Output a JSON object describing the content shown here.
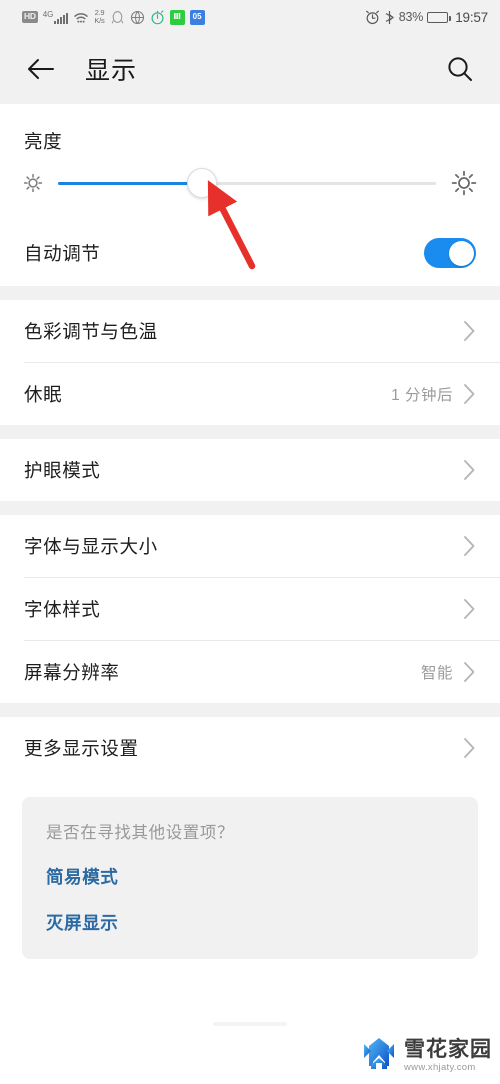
{
  "statusbar": {
    "hd_badge": "HD",
    "network_gen": "4G",
    "data_speed_value": "2.9",
    "data_speed_unit": "K/s",
    "icons": [
      "hd-badge",
      "signal-bars-icon",
      "wifi-icon",
      "data-speed-indicator",
      "qq-penguin-icon",
      "globe-icon",
      "stopwatch-icon",
      "green-app-icon",
      "blue-app-icon",
      "alarm-clock-icon",
      "bluetooth-icon",
      "battery-icon"
    ],
    "green_app_glyph": "Ⅲ",
    "blue_app_glyph": "05",
    "battery_percent": "83%",
    "battery_level": 83,
    "clock": "19:57"
  },
  "header": {
    "back_icon": "arrow-left-icon",
    "title": "显示",
    "search_icon": "search-icon"
  },
  "brightness": {
    "section_title": "亮度",
    "low_icon": "sun-low-icon",
    "high_icon": "sun-high-icon",
    "slider_percent": 38,
    "auto_row": {
      "label": "自动调节",
      "toggle_on": true,
      "toggle_color": "#1a8cf0"
    }
  },
  "groups": [
    {
      "rows": [
        {
          "label": "色彩调节与色温",
          "value": "",
          "chevron": true
        },
        {
          "label": "休眠",
          "value": "1 分钟后",
          "chevron": true
        }
      ]
    },
    {
      "rows": [
        {
          "label": "护眼模式",
          "value": "",
          "chevron": true
        }
      ]
    },
    {
      "rows": [
        {
          "label": "字体与显示大小",
          "value": "",
          "chevron": true
        },
        {
          "label": "字体样式",
          "value": "",
          "chevron": true
        },
        {
          "label": "屏幕分辨率",
          "value": "智能",
          "chevron": true
        }
      ]
    },
    {
      "rows": [
        {
          "label": "更多显示设置",
          "value": "",
          "chevron": true
        }
      ]
    }
  ],
  "suggestion": {
    "question": "是否在寻找其他设置项？",
    "links": [
      "简易模式",
      "灭屏显示"
    ],
    "link_color": "#2b6aa3"
  },
  "annotation": {
    "arrow_color": "#e8302a",
    "points_to": "brightness-slider-thumb"
  },
  "watermark": {
    "logo_icon": "snowflake-house-logo",
    "name": "雪花家园",
    "url": "www.xhjaty.com"
  }
}
